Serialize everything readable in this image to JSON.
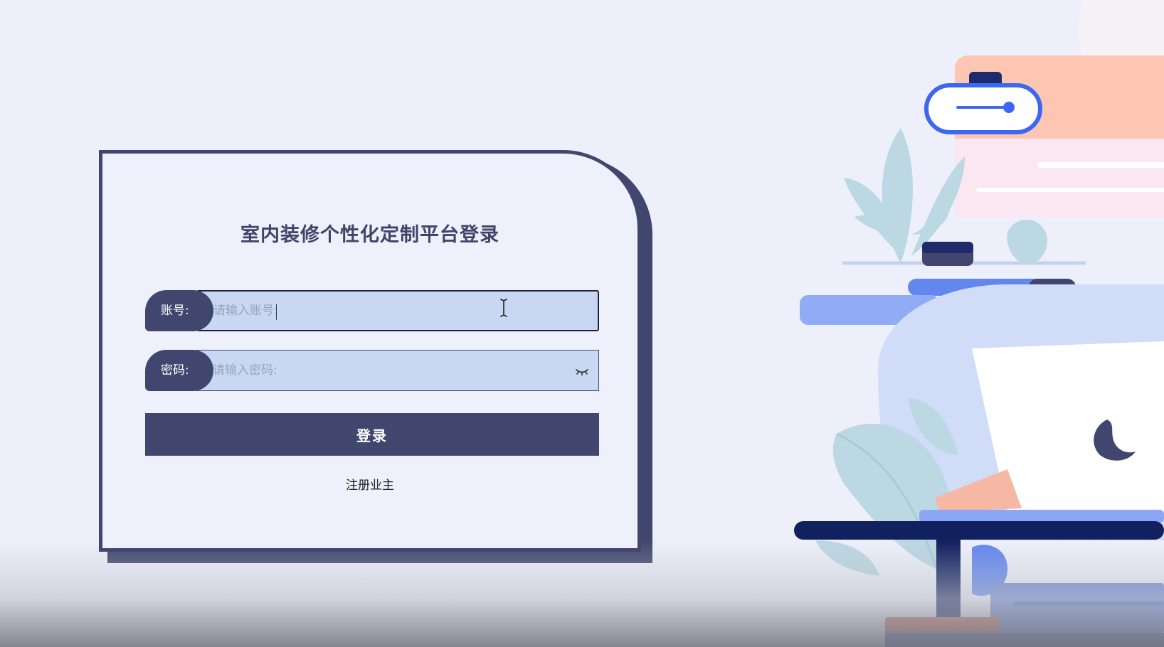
{
  "login": {
    "title": "室内装修个性化定制平台登录",
    "account": {
      "label": "账号:",
      "placeholder": "请输入账号:",
      "value": ""
    },
    "password": {
      "label": "密码:",
      "placeholder": "请输入密码:",
      "value": "",
      "toggle_icon": "eye-closed-icon"
    },
    "submit_label": "登录",
    "register_label": "注册业主"
  },
  "colors": {
    "primary": "#41466e",
    "background": "#edf0fa",
    "input_background": "#c9d8f2",
    "card_background": "#eef1fb"
  }
}
